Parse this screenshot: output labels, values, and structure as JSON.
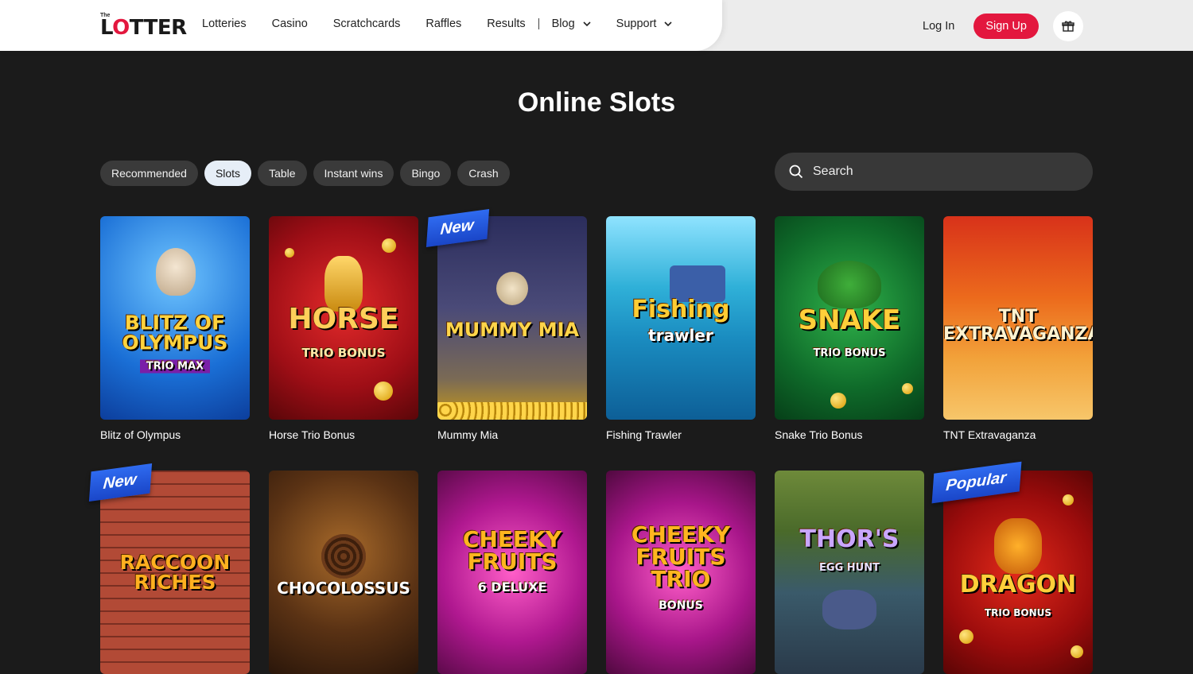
{
  "header": {
    "logo_small": "The",
    "logo_word_pre": "L",
    "logo_word_o": "O",
    "logo_word_post": "TTER",
    "nav": [
      "Lotteries",
      "Casino",
      "Scratchcards",
      "Raffles",
      "Results",
      "Blog",
      "Support"
    ],
    "login_label": "Log In",
    "signup_label": "Sign Up",
    "gift_icon": "gift-icon"
  },
  "page": {
    "title": "Online Slots"
  },
  "filters": {
    "pills": [
      "Recommended",
      "Slots",
      "Table",
      "Instant wins",
      "Bingo",
      "Crash"
    ],
    "active": "Slots"
  },
  "search": {
    "placeholder": "Search"
  },
  "games": [
    {
      "title": "Blitz of Olympus",
      "art": "BLITZ OF OLYMPUS",
      "sub": "TRIO MAX",
      "badge": ""
    },
    {
      "title": "Horse Trio Bonus",
      "art": "HORSE",
      "sub": "TRIO BONUS",
      "badge": ""
    },
    {
      "title": "Mummy Mia",
      "art": "MUMMY MIA",
      "sub": "",
      "badge": "New"
    },
    {
      "title": "Fishing Trawler",
      "art": "Fishing",
      "sub": "trawler",
      "badge": ""
    },
    {
      "title": "Snake Trio Bonus",
      "art": "SNAKE",
      "sub": "TRIO BONUS",
      "badge": ""
    },
    {
      "title": "TNT Extravaganza",
      "art": "TNT EXTRAVAGANZA",
      "sub": "",
      "badge": ""
    },
    {
      "title": "",
      "art": "RACCOON RICHES",
      "sub": "",
      "badge": "New"
    },
    {
      "title": "",
      "art": "CHOCOLOSSUS",
      "sub": "",
      "badge": ""
    },
    {
      "title": "",
      "art": "CHEEKY FRUITS",
      "sub": "6 DELUXE",
      "badge": ""
    },
    {
      "title": "",
      "art": "CHEEKY FRUITS TRIO",
      "sub": "BONUS",
      "badge": ""
    },
    {
      "title": "",
      "art": "THOR'S",
      "sub": "EGG HUNT",
      "badge": ""
    },
    {
      "title": "",
      "art": "DRAGON",
      "sub": "TRIO BONUS",
      "badge": "Popular"
    }
  ]
}
